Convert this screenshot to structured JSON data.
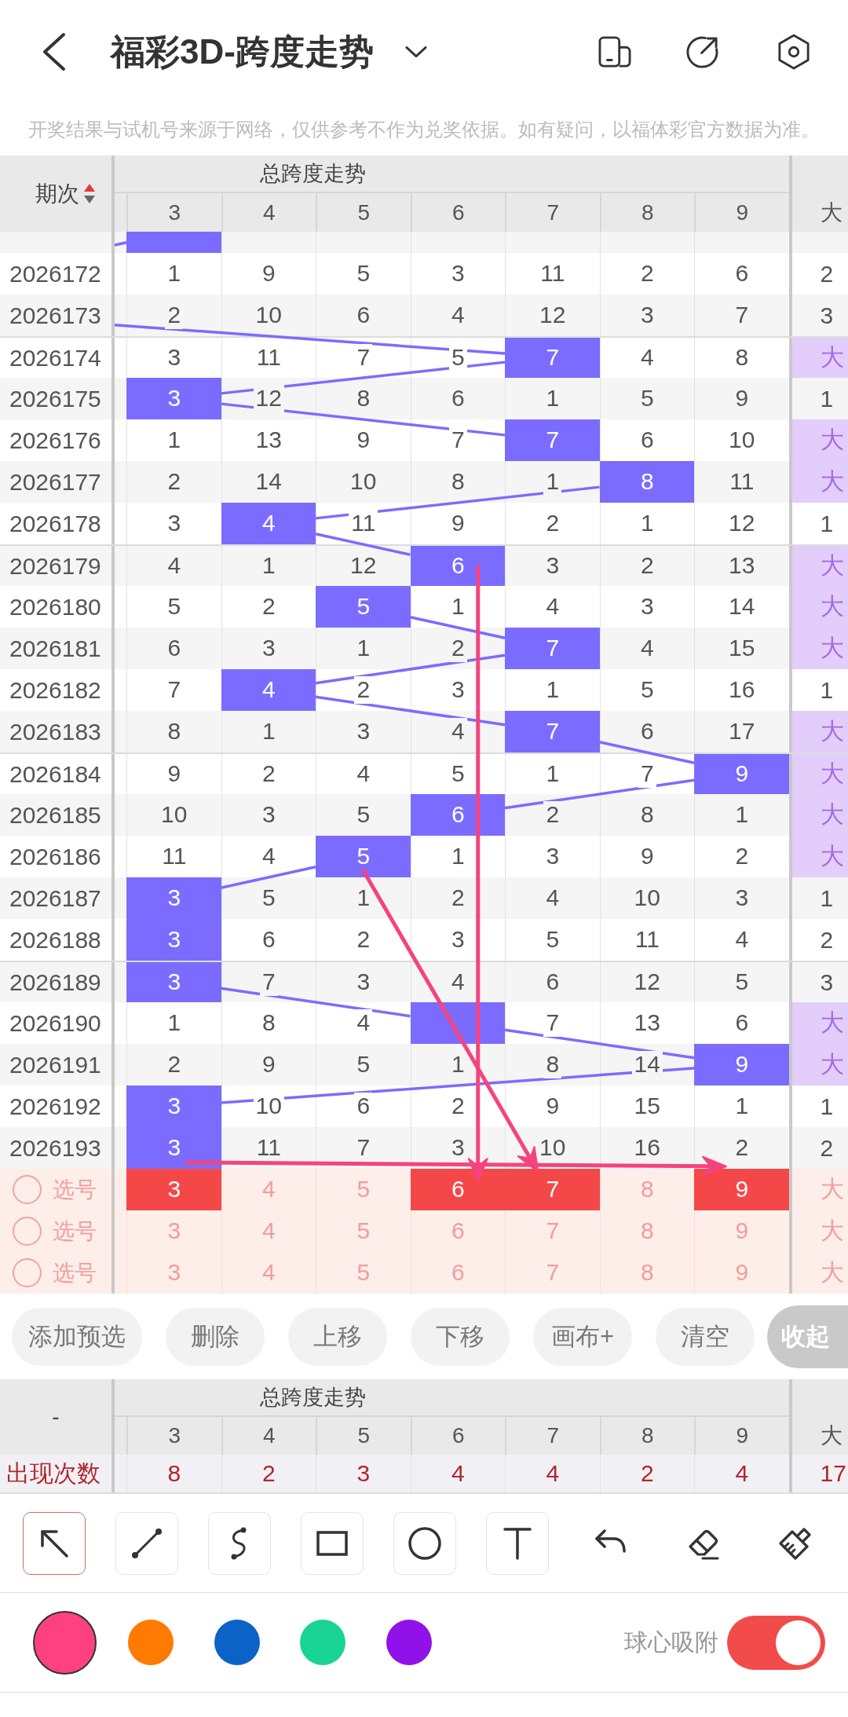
{
  "header": {
    "title": "福彩3D-跨度走势"
  },
  "notice": "开奖结果与试机号来源于网络，仅供参考不作为兑奖依据。如有疑问，以福体彩官方数据为准。",
  "trend_table": {
    "period_header": "期次",
    "group_header": "总跨度走势",
    "columns": [
      "3",
      "4",
      "5",
      "6",
      "7",
      "8",
      "9"
    ],
    "extra_column": "大",
    "cut_row": {
      "cells": [
        {
          "hit": true
        },
        {
          "hit": false
        },
        {
          "hit": false
        },
        {
          "hit": false
        },
        {
          "hit": false
        },
        {
          "hit": false
        },
        {
          "hit": false
        }
      ]
    },
    "rows": [
      {
        "period": "2026172",
        "cells": [
          {
            "value": "1",
            "hit": false
          },
          {
            "value": "9",
            "hit": false
          },
          {
            "value": "5",
            "hit": false
          },
          {
            "value": "3",
            "hit": false
          },
          {
            "value": "11",
            "hit": false
          },
          {
            "value": "2",
            "hit": false
          },
          {
            "value": "6",
            "hit": false
          }
        ],
        "extra": {
          "value": "2",
          "hit": false
        }
      },
      {
        "period": "2026173",
        "cells": [
          {
            "value": "2",
            "hit": false
          },
          {
            "value": "10",
            "hit": false
          },
          {
            "value": "6",
            "hit": false
          },
          {
            "value": "4",
            "hit": false
          },
          {
            "value": "12",
            "hit": false
          },
          {
            "value": "3",
            "hit": false
          },
          {
            "value": "7",
            "hit": false
          }
        ],
        "extra": {
          "value": "3",
          "hit": false
        }
      },
      {
        "period": "2026174",
        "cells": [
          {
            "value": "3",
            "hit": false
          },
          {
            "value": "11",
            "hit": false
          },
          {
            "value": "7",
            "hit": false
          },
          {
            "value": "5",
            "hit": false
          },
          {
            "value": "7",
            "hit": true
          },
          {
            "value": "4",
            "hit": false
          },
          {
            "value": "8",
            "hit": false
          }
        ],
        "extra": {
          "value": "大",
          "hit": true
        }
      },
      {
        "period": "2026175",
        "cells": [
          {
            "value": "3",
            "hit": true
          },
          {
            "value": "12",
            "hit": false
          },
          {
            "value": "8",
            "hit": false
          },
          {
            "value": "6",
            "hit": false
          },
          {
            "value": "1",
            "hit": false
          },
          {
            "value": "5",
            "hit": false
          },
          {
            "value": "9",
            "hit": false
          }
        ],
        "extra": {
          "value": "1",
          "hit": false
        }
      },
      {
        "period": "2026176",
        "cells": [
          {
            "value": "1",
            "hit": false
          },
          {
            "value": "13",
            "hit": false
          },
          {
            "value": "9",
            "hit": false
          },
          {
            "value": "7",
            "hit": false
          },
          {
            "value": "7",
            "hit": true
          },
          {
            "value": "6",
            "hit": false
          },
          {
            "value": "10",
            "hit": false
          }
        ],
        "extra": {
          "value": "大",
          "hit": true
        }
      },
      {
        "period": "2026177",
        "cells": [
          {
            "value": "2",
            "hit": false
          },
          {
            "value": "14",
            "hit": false
          },
          {
            "value": "10",
            "hit": false
          },
          {
            "value": "8",
            "hit": false
          },
          {
            "value": "1",
            "hit": false
          },
          {
            "value": "8",
            "hit": true
          },
          {
            "value": "11",
            "hit": false
          }
        ],
        "extra": {
          "value": "大",
          "hit": true
        }
      },
      {
        "period": "2026178",
        "cells": [
          {
            "value": "3",
            "hit": false
          },
          {
            "value": "4",
            "hit": true
          },
          {
            "value": "11",
            "hit": false
          },
          {
            "value": "9",
            "hit": false
          },
          {
            "value": "2",
            "hit": false
          },
          {
            "value": "1",
            "hit": false
          },
          {
            "value": "12",
            "hit": false
          }
        ],
        "extra": {
          "value": "1",
          "hit": false
        }
      },
      {
        "period": "2026179",
        "cells": [
          {
            "value": "4",
            "hit": false
          },
          {
            "value": "1",
            "hit": false
          },
          {
            "value": "12",
            "hit": false
          },
          {
            "value": "6",
            "hit": true
          },
          {
            "value": "3",
            "hit": false
          },
          {
            "value": "2",
            "hit": false
          },
          {
            "value": "13",
            "hit": false
          }
        ],
        "extra": {
          "value": "大",
          "hit": true
        }
      },
      {
        "period": "2026180",
        "cells": [
          {
            "value": "5",
            "hit": false
          },
          {
            "value": "2",
            "hit": false
          },
          {
            "value": "5",
            "hit": true
          },
          {
            "value": "1",
            "hit": false
          },
          {
            "value": "4",
            "hit": false
          },
          {
            "value": "3",
            "hit": false
          },
          {
            "value": "14",
            "hit": false
          }
        ],
        "extra": {
          "value": "大",
          "hit": true
        }
      },
      {
        "period": "2026181",
        "cells": [
          {
            "value": "6",
            "hit": false
          },
          {
            "value": "3",
            "hit": false
          },
          {
            "value": "1",
            "hit": false
          },
          {
            "value": "2",
            "hit": false
          },
          {
            "value": "7",
            "hit": true
          },
          {
            "value": "4",
            "hit": false
          },
          {
            "value": "15",
            "hit": false
          }
        ],
        "extra": {
          "value": "大",
          "hit": true
        }
      },
      {
        "period": "2026182",
        "cells": [
          {
            "value": "7",
            "hit": false
          },
          {
            "value": "4",
            "hit": true
          },
          {
            "value": "2",
            "hit": false
          },
          {
            "value": "3",
            "hit": false
          },
          {
            "value": "1",
            "hit": false
          },
          {
            "value": "5",
            "hit": false
          },
          {
            "value": "16",
            "hit": false
          }
        ],
        "extra": {
          "value": "1",
          "hit": false
        }
      },
      {
        "period": "2026183",
        "cells": [
          {
            "value": "8",
            "hit": false
          },
          {
            "value": "1",
            "hit": false
          },
          {
            "value": "3",
            "hit": false
          },
          {
            "value": "4",
            "hit": false
          },
          {
            "value": "7",
            "hit": true
          },
          {
            "value": "6",
            "hit": false
          },
          {
            "value": "17",
            "hit": false
          }
        ],
        "extra": {
          "value": "大",
          "hit": true
        }
      },
      {
        "period": "2026184",
        "cells": [
          {
            "value": "9",
            "hit": false
          },
          {
            "value": "2",
            "hit": false
          },
          {
            "value": "4",
            "hit": false
          },
          {
            "value": "5",
            "hit": false
          },
          {
            "value": "1",
            "hit": false
          },
          {
            "value": "7",
            "hit": false
          },
          {
            "value": "9",
            "hit": true
          }
        ],
        "extra": {
          "value": "大",
          "hit": true
        }
      },
      {
        "period": "2026185",
        "cells": [
          {
            "value": "10",
            "hit": false
          },
          {
            "value": "3",
            "hit": false
          },
          {
            "value": "5",
            "hit": false
          },
          {
            "value": "6",
            "hit": true
          },
          {
            "value": "2",
            "hit": false
          },
          {
            "value": "8",
            "hit": false
          },
          {
            "value": "1",
            "hit": false
          }
        ],
        "extra": {
          "value": "大",
          "hit": true
        }
      },
      {
        "period": "2026186",
        "cells": [
          {
            "value": "11",
            "hit": false
          },
          {
            "value": "4",
            "hit": false
          },
          {
            "value": "5",
            "hit": true
          },
          {
            "value": "1",
            "hit": false
          },
          {
            "value": "3",
            "hit": false
          },
          {
            "value": "9",
            "hit": false
          },
          {
            "value": "2",
            "hit": false
          }
        ],
        "extra": {
          "value": "大",
          "hit": true
        }
      },
      {
        "period": "2026187",
        "cells": [
          {
            "value": "3",
            "hit": true
          },
          {
            "value": "5",
            "hit": false
          },
          {
            "value": "1",
            "hit": false
          },
          {
            "value": "2",
            "hit": false
          },
          {
            "value": "4",
            "hit": false
          },
          {
            "value": "10",
            "hit": false
          },
          {
            "value": "3",
            "hit": false
          }
        ],
        "extra": {
          "value": "1",
          "hit": false
        }
      },
      {
        "period": "2026188",
        "cells": [
          {
            "value": "3",
            "hit": true
          },
          {
            "value": "6",
            "hit": false
          },
          {
            "value": "2",
            "hit": false
          },
          {
            "value": "3",
            "hit": false
          },
          {
            "value": "5",
            "hit": false
          },
          {
            "value": "11",
            "hit": false
          },
          {
            "value": "4",
            "hit": false
          }
        ],
        "extra": {
          "value": "2",
          "hit": false
        }
      },
      {
        "period": "2026189",
        "cells": [
          {
            "value": "3",
            "hit": true
          },
          {
            "value": "7",
            "hit": false
          },
          {
            "value": "3",
            "hit": false
          },
          {
            "value": "4",
            "hit": false
          },
          {
            "value": "6",
            "hit": false
          },
          {
            "value": "12",
            "hit": false
          },
          {
            "value": "5",
            "hit": false
          }
        ],
        "extra": {
          "value": "3",
          "hit": false
        }
      },
      {
        "period": "2026190",
        "cells": [
          {
            "value": "1",
            "hit": false
          },
          {
            "value": "8",
            "hit": false
          },
          {
            "value": "4",
            "hit": false
          },
          {
            "hit": true
          },
          {
            "value": "7",
            "hit": false
          },
          {
            "value": "13",
            "hit": false
          },
          {
            "value": "6",
            "hit": false
          }
        ],
        "extra": {
          "value": "大",
          "hit": true
        }
      },
      {
        "period": "2026191",
        "cells": [
          {
            "value": "2",
            "hit": false
          },
          {
            "value": "9",
            "hit": false
          },
          {
            "value": "5",
            "hit": false
          },
          {
            "value": "1",
            "hit": false
          },
          {
            "value": "8",
            "hit": false
          },
          {
            "value": "14",
            "hit": false
          },
          {
            "value": "9",
            "hit": true
          }
        ],
        "extra": {
          "value": "大",
          "hit": true
        }
      },
      {
        "period": "2026192",
        "cells": [
          {
            "value": "3",
            "hit": true
          },
          {
            "value": "10",
            "hit": false
          },
          {
            "value": "6",
            "hit": false
          },
          {
            "value": "2",
            "hit": false
          },
          {
            "value": "9",
            "hit": false
          },
          {
            "value": "15",
            "hit": false
          },
          {
            "value": "1",
            "hit": false
          }
        ],
        "extra": {
          "value": "1",
          "hit": false
        }
      },
      {
        "period": "2026193",
        "cells": [
          {
            "value": "3",
            "hit": true
          },
          {
            "value": "11",
            "hit": false
          },
          {
            "value": "7",
            "hit": false
          },
          {
            "value": "3",
            "hit": false
          },
          {
            "value": "10",
            "hit": false
          },
          {
            "value": "16",
            "hit": false
          },
          {
            "value": "2",
            "hit": false
          }
        ],
        "extra": {
          "value": "2",
          "hit": false
        }
      }
    ],
    "pick_rows": [
      {
        "label": "选号",
        "checked": false,
        "cells": [
          {
            "value": "3",
            "selected": true
          },
          {
            "value": "4",
            "selected": false
          },
          {
            "value": "5",
            "selected": false
          },
          {
            "value": "6",
            "selected": true
          },
          {
            "value": "7",
            "selected": true
          },
          {
            "value": "8",
            "selected": false
          },
          {
            "value": "9",
            "selected": true
          }
        ],
        "extra": {
          "value": "大",
          "selected": false
        }
      },
      {
        "label": "选号",
        "checked": false,
        "cells": [
          {
            "value": "3",
            "selected": false
          },
          {
            "value": "4",
            "selected": false
          },
          {
            "value": "5",
            "selected": false
          },
          {
            "value": "6",
            "selected": false
          },
          {
            "value": "7",
            "selected": false
          },
          {
            "value": "8",
            "selected": false
          },
          {
            "value": "9",
            "selected": false
          }
        ],
        "extra": {
          "value": "大",
          "selected": false
        }
      },
      {
        "label": "选号",
        "checked": false,
        "cells": [
          {
            "value": "3",
            "selected": false
          },
          {
            "value": "4",
            "selected": false
          },
          {
            "value": "5",
            "selected": false
          },
          {
            "value": "6",
            "selected": false
          },
          {
            "value": "7",
            "selected": false
          },
          {
            "value": "8",
            "selected": false
          },
          {
            "value": "9",
            "selected": false
          }
        ],
        "extra": {
          "value": "大",
          "selected": false
        }
      }
    ]
  },
  "actions": [
    {
      "label": "添加预选",
      "kind": "normal"
    },
    {
      "label": "删除",
      "kind": "normal"
    },
    {
      "label": "上移",
      "kind": "normal"
    },
    {
      "label": "下移",
      "kind": "normal"
    },
    {
      "label": "画布+",
      "kind": "normal"
    },
    {
      "label": "清空",
      "kind": "normal"
    },
    {
      "label": "收起",
      "kind": "collapse"
    }
  ],
  "stats_table": {
    "corner": "-",
    "group_header": "总跨度走势",
    "columns": [
      "3",
      "4",
      "5",
      "6",
      "7",
      "8",
      "9"
    ],
    "extra_column": "大",
    "row_label": "出现次数",
    "values": [
      "8",
      "2",
      "3",
      "4",
      "4",
      "2",
      "4"
    ],
    "extra_value": "17"
  },
  "shape_tools": [
    {
      "kind": "arrow",
      "selected": true
    },
    {
      "kind": "line",
      "selected": false
    },
    {
      "kind": "curve",
      "selected": false
    },
    {
      "kind": "rect",
      "selected": false
    },
    {
      "kind": "circle",
      "selected": false
    },
    {
      "kind": "text",
      "selected": false
    }
  ],
  "edit_tools": [
    {
      "kind": "undo"
    },
    {
      "kind": "eraser"
    },
    {
      "kind": "brush"
    }
  ],
  "colors": [
    {
      "color": "#ff4081",
      "selected": true
    },
    {
      "color": "#ff7a00",
      "selected": false
    },
    {
      "color": "#0b63c8",
      "selected": false
    },
    {
      "color": "#1ad495",
      "selected": false
    },
    {
      "color": "#9012e8",
      "selected": false
    }
  ],
  "snap": {
    "label": "球心吸附",
    "on": true
  }
}
